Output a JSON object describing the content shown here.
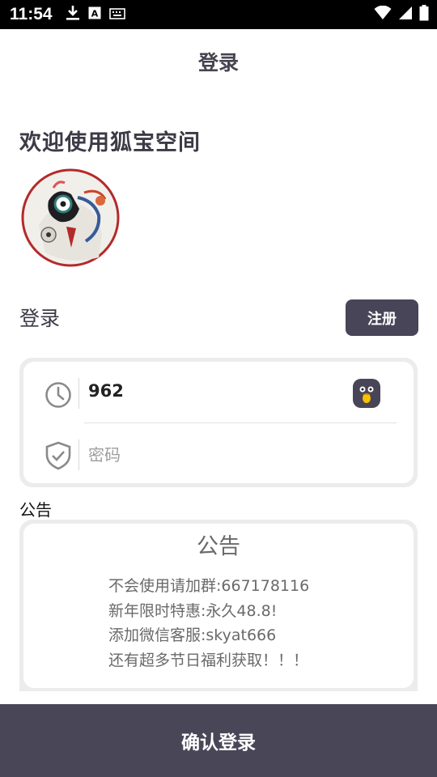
{
  "status_bar": {
    "time": "11:54",
    "icons": [
      "download-icon",
      "keyboard-a-icon",
      "keyboard-icon"
    ],
    "right_icons": [
      "wifi-icon",
      "signal-icon",
      "battery-icon"
    ]
  },
  "app_bar": {
    "title": "登录"
  },
  "welcome_text": "欢迎使用狐宝空间",
  "login_section": {
    "label": "登录",
    "register_label": "注册"
  },
  "form": {
    "account_icon": "clock-icon",
    "account_value": "962",
    "qq_icon": "qq-penguin-icon",
    "password_icon": "shield-check-icon",
    "password_placeholder": "密码"
  },
  "notice": {
    "section_label": "公告",
    "title": "公告",
    "lines": [
      "不会使用请加群:667178116",
      "新年限时特惠:永久48.8!",
      "添加微信客服:skyat666",
      "还有超多节日福利获取！！！"
    ]
  },
  "confirm_button": {
    "label": "确认登录"
  },
  "colors": {
    "primary": "#474557",
    "title_text": "#3b3a46",
    "card_border": "#ececec",
    "notice_text": "#6a6a6a"
  }
}
